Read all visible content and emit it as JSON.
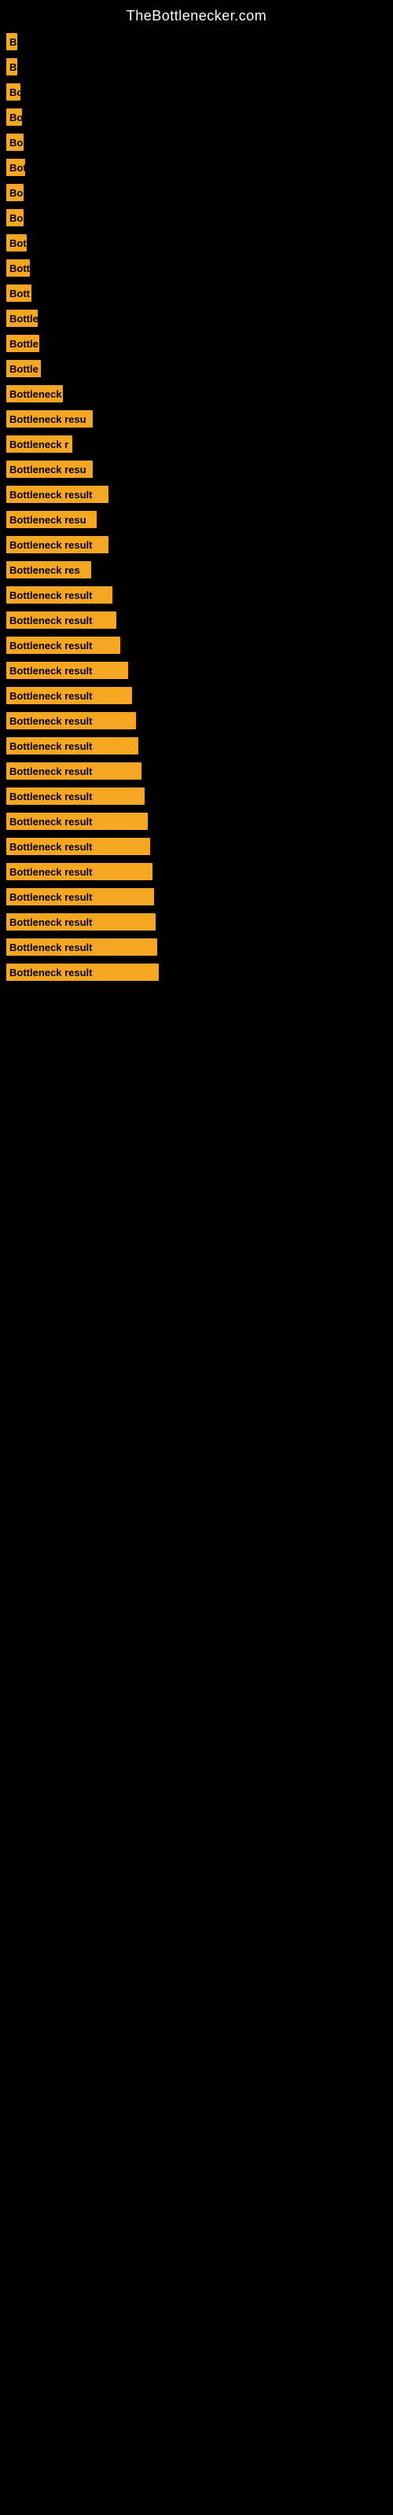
{
  "header": {
    "title": "TheBottlenecker.com"
  },
  "bars": [
    {
      "id": 1,
      "label": "B",
      "width": 14
    },
    {
      "id": 2,
      "label": "B",
      "width": 14
    },
    {
      "id": 3,
      "label": "Bo",
      "width": 18
    },
    {
      "id": 4,
      "label": "Bo",
      "width": 20
    },
    {
      "id": 5,
      "label": "Bo",
      "width": 22
    },
    {
      "id": 6,
      "label": "Bot",
      "width": 24
    },
    {
      "id": 7,
      "label": "Bo",
      "width": 22
    },
    {
      "id": 8,
      "label": "Bo",
      "width": 22
    },
    {
      "id": 9,
      "label": "Bot",
      "width": 26
    },
    {
      "id": 10,
      "label": "Bott",
      "width": 30
    },
    {
      "id": 11,
      "label": "Bott",
      "width": 32
    },
    {
      "id": 12,
      "label": "Bottle",
      "width": 40
    },
    {
      "id": 13,
      "label": "Bottle",
      "width": 42
    },
    {
      "id": 14,
      "label": "Bottle",
      "width": 44
    },
    {
      "id": 15,
      "label": "Bottleneck",
      "width": 72
    },
    {
      "id": 16,
      "label": "Bottleneck resu",
      "width": 110
    },
    {
      "id": 17,
      "label": "Bottleneck r",
      "width": 84
    },
    {
      "id": 18,
      "label": "Bottleneck resu",
      "width": 110
    },
    {
      "id": 19,
      "label": "Bottleneck result",
      "width": 130
    },
    {
      "id": 20,
      "label": "Bottleneck resu",
      "width": 115
    },
    {
      "id": 21,
      "label": "Bottleneck result",
      "width": 130
    },
    {
      "id": 22,
      "label": "Bottleneck res",
      "width": 108
    },
    {
      "id": 23,
      "label": "Bottleneck result",
      "width": 135
    },
    {
      "id": 24,
      "label": "Bottleneck result",
      "width": 140
    },
    {
      "id": 25,
      "label": "Bottleneck result",
      "width": 145
    },
    {
      "id": 26,
      "label": "Bottleneck result",
      "width": 155
    },
    {
      "id": 27,
      "label": "Bottleneck result",
      "width": 160
    },
    {
      "id": 28,
      "label": "Bottleneck result",
      "width": 165
    },
    {
      "id": 29,
      "label": "Bottleneck result",
      "width": 168
    },
    {
      "id": 30,
      "label": "Bottleneck result",
      "width": 172
    },
    {
      "id": 31,
      "label": "Bottleneck result",
      "width": 176
    },
    {
      "id": 32,
      "label": "Bottleneck result",
      "width": 180
    },
    {
      "id": 33,
      "label": "Bottleneck result",
      "width": 183
    },
    {
      "id": 34,
      "label": "Bottleneck result",
      "width": 186
    },
    {
      "id": 35,
      "label": "Bottleneck result",
      "width": 188
    },
    {
      "id": 36,
      "label": "Bottleneck result",
      "width": 190
    },
    {
      "id": 37,
      "label": "Bottleneck result",
      "width": 192
    },
    {
      "id": 38,
      "label": "Bottleneck result",
      "width": 194
    }
  ]
}
